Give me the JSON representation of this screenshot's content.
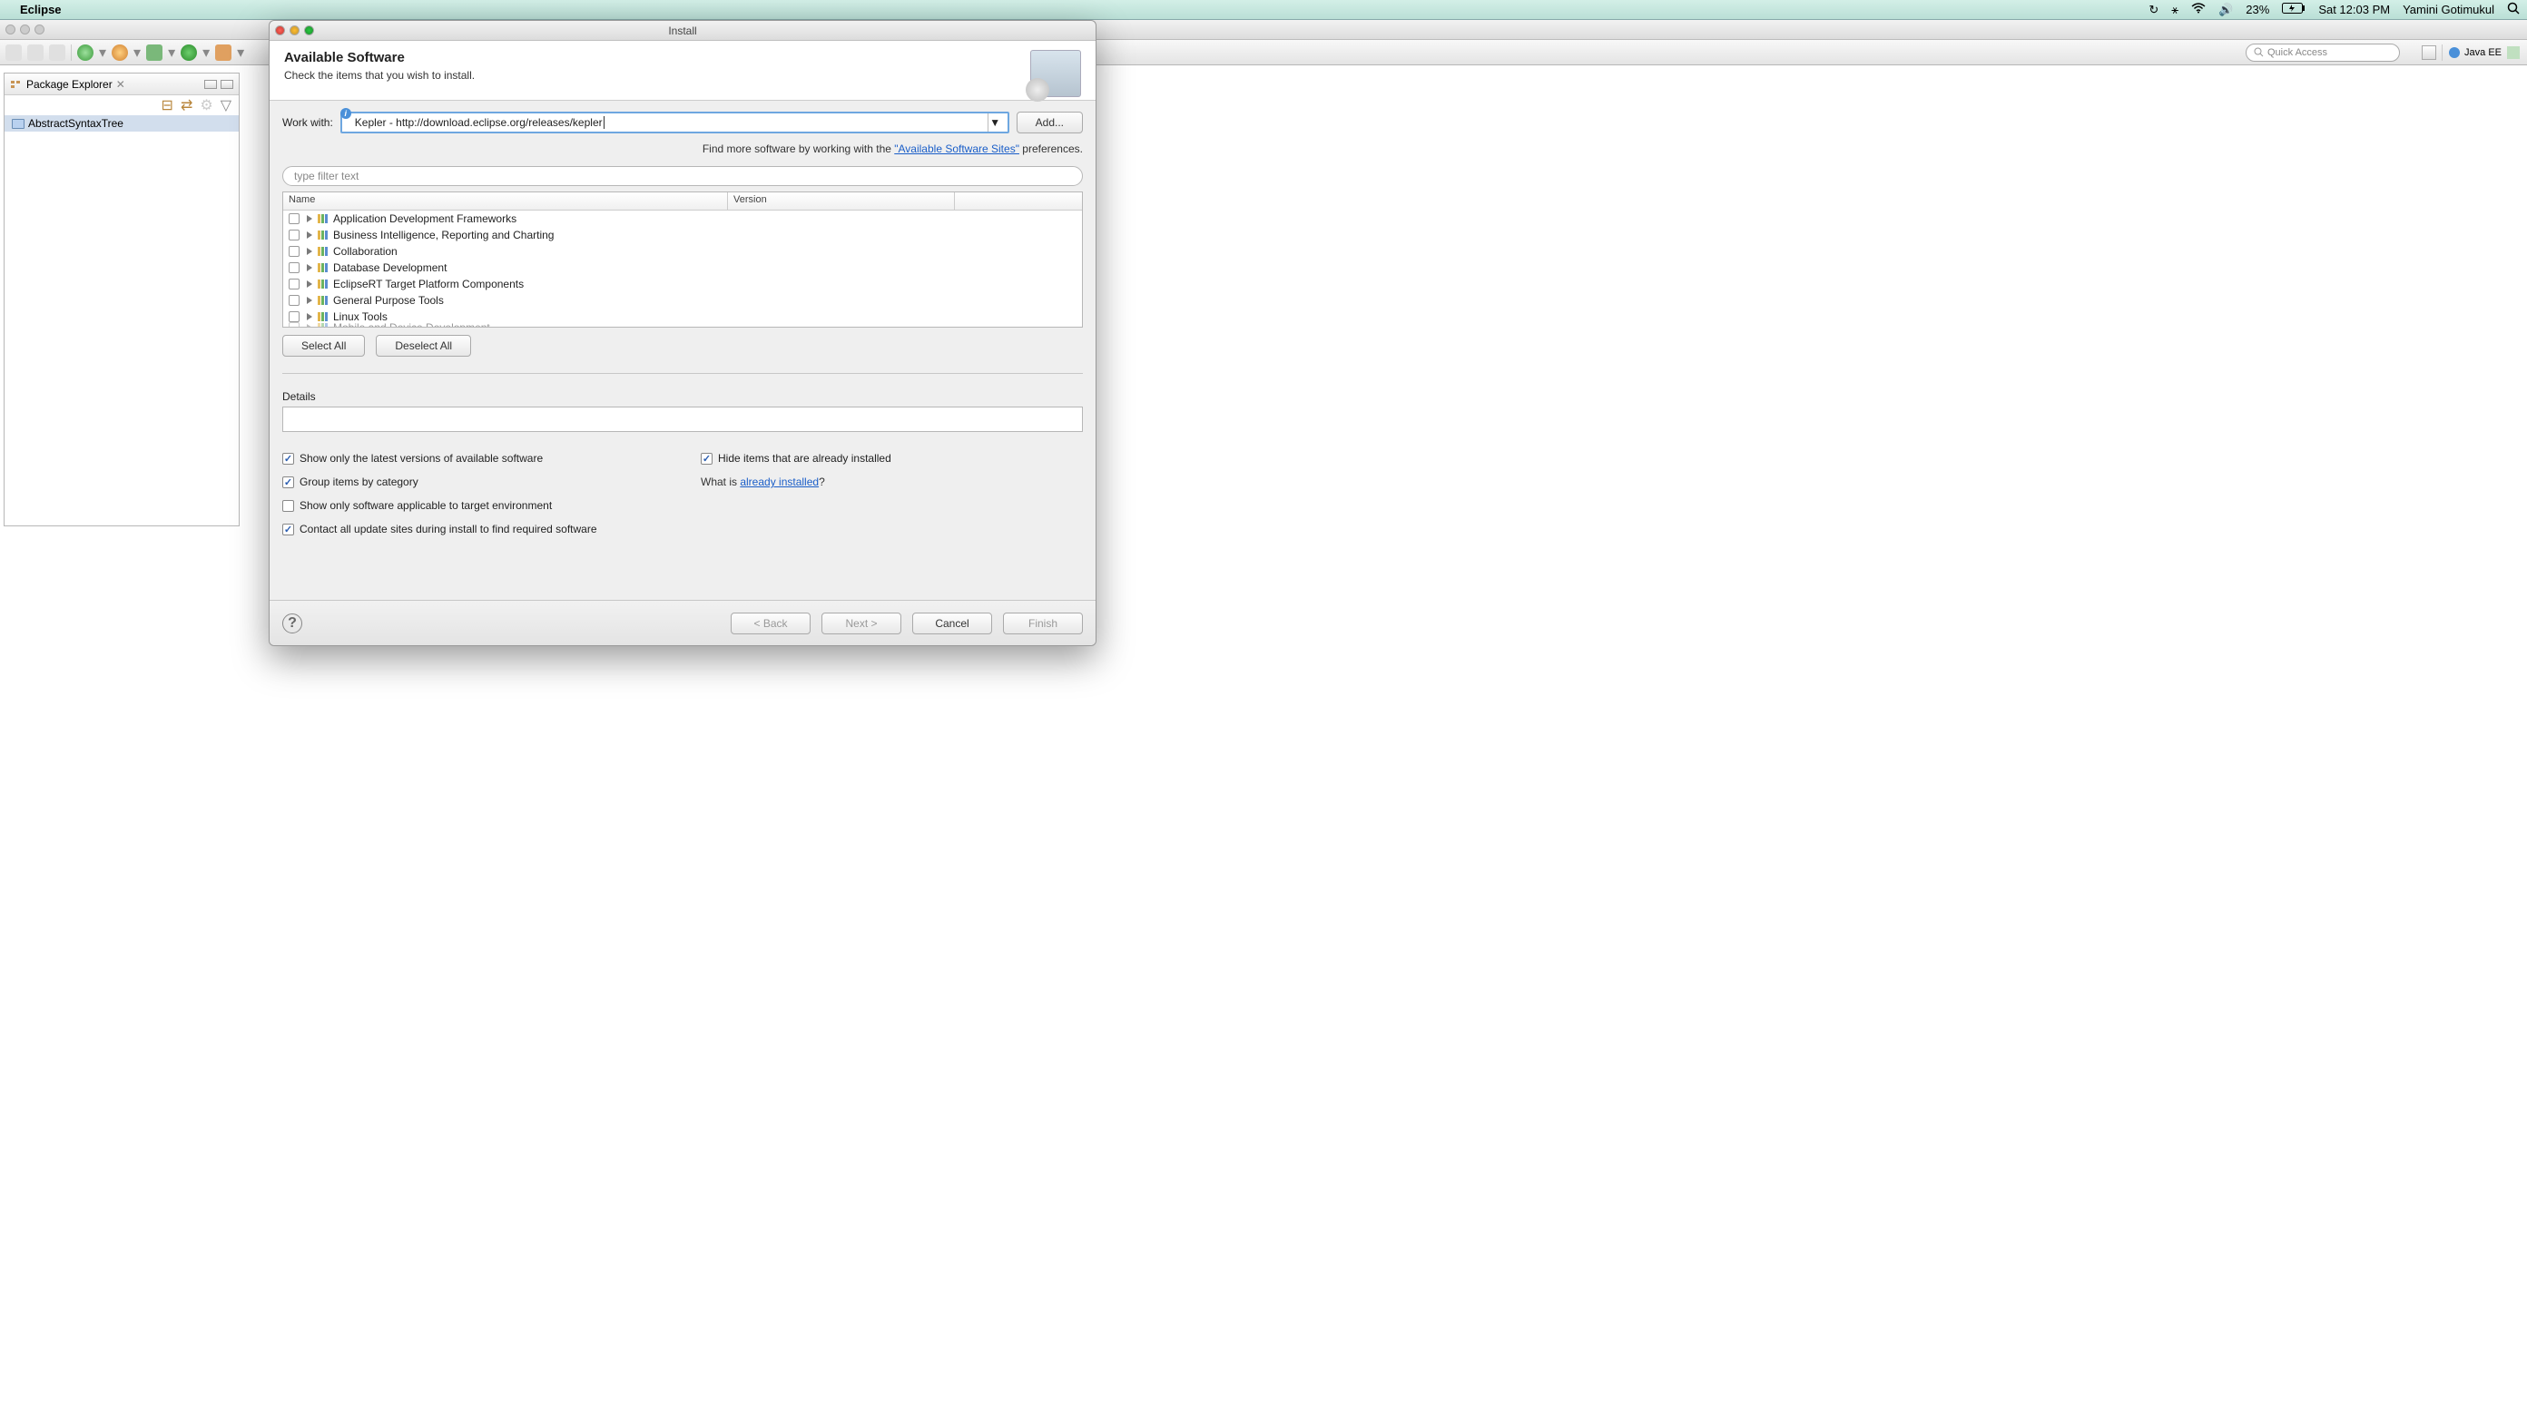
{
  "menubar": {
    "app": "Eclipse",
    "battery": "23%",
    "time": "Sat 12:03 PM",
    "user": "Yamini Gotimukul"
  },
  "toolbar": {
    "quick_access": "Quick Access",
    "perspective": "Java EE"
  },
  "package_explorer": {
    "title": "Package Explorer",
    "project": "AbstractSyntaxTree"
  },
  "dialog": {
    "window_title": "Install",
    "title": "Available Software",
    "subtitle": "Check the items that you wish to install.",
    "work_with_label": "Work with:",
    "work_with_value": "Kepler - http://download.eclipse.org/releases/kepler",
    "add_button": "Add...",
    "hint_prefix": "Find more software by working with the ",
    "hint_link": "\"Available Software Sites\"",
    "hint_suffix": " preferences.",
    "filter_placeholder": "type filter text",
    "col_name": "Name",
    "col_version": "Version",
    "categories": [
      "Application Development Frameworks",
      "Business Intelligence, Reporting and Charting",
      "Collaboration",
      "Database Development",
      "EclipseRT Target Platform Components",
      "General Purpose Tools",
      "Linux Tools",
      "Mobile and Device Development"
    ],
    "select_all": "Select All",
    "deselect_all": "Deselect All",
    "details_label": "Details",
    "opt_latest": "Show only the latest versions of available software",
    "opt_hide": "Hide items that are already installed",
    "opt_group": "Group items by category",
    "opt_target": "Show only software applicable to target environment",
    "opt_contact": "Contact all update sites during install to find required software",
    "already_prefix": "What is ",
    "already_link": "already installed",
    "already_suffix": "?",
    "back": "< Back",
    "next": "Next >",
    "cancel": "Cancel",
    "finish": "Finish"
  }
}
